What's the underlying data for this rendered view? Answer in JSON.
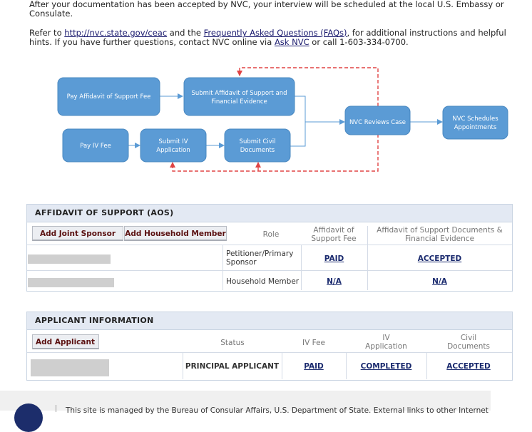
{
  "intro": {
    "p1": "After your documentation has been accepted by NVC, your interview will be scheduled at the local U.S. Embassy or Consulate.",
    "p2_pre": "Refer to ",
    "p2_link1": "http://nvc.state.gov/ceac",
    "p2_mid": " and the ",
    "p2_link2": "Frequently Asked Questions (FAQs)",
    "p2_mid2": ", for additional instructions and helpful hints. If you have further questions, contact NVC online via ",
    "p2_link3": "Ask NVC",
    "p2_post": " or call 1-603-334-0700."
  },
  "flowchart": {
    "box_color": "#5b9bd5",
    "arrow_color": "#5b9bd5",
    "dash_color": "#e04444",
    "steps": {
      "pay_aos_fee": "Pay Affidavit of Support Fee",
      "submit_aos_line1": "Submit Affidavit of Support and",
      "submit_aos_line2": "Financial Evidence",
      "pay_iv_fee": "Pay IV Fee",
      "submit_iv_line1": "Submit IV",
      "submit_iv_line2": "Application",
      "submit_civil_line1": "Submit Civil",
      "submit_civil_line2": "Documents",
      "nvc_reviews": "NVC Reviews Case",
      "nvc_schedules_line1": "NVC Schedules",
      "nvc_schedules_line2": "Appointments"
    }
  },
  "aos": {
    "title": "AFFIDAVIT OF SUPPORT (AOS)",
    "add_joint_sponsor": "Add Joint Sponsor",
    "add_household_member": "Add Household Member",
    "col_role": "Role",
    "col_fee_line1": "Affidavit of",
    "col_fee_line2": "Support Fee",
    "col_docs_line1": "Affidavit of Support Documents &",
    "col_docs_line2": "Financial Evidence",
    "rows": [
      {
        "role_line1": "Petitioner/Primary",
        "role_line2": "Sponsor",
        "fee": "PAID",
        "docs": "ACCEPTED"
      },
      {
        "role_line1": "Household Member",
        "role_line2": "",
        "fee": "N/A",
        "docs": "N/A"
      }
    ]
  },
  "applicant": {
    "title": "APPLICANT INFORMATION",
    "add_applicant": "Add Applicant",
    "col_status": "Status",
    "col_iv_fee": "IV Fee",
    "col_iv_app_line1": "IV",
    "col_iv_app_line2": "Application",
    "col_civil_line1": "Civil",
    "col_civil_line2": "Documents",
    "rows": [
      {
        "status": "PRINCIPAL APPLICANT",
        "iv_fee": "PAID",
        "iv_app": "COMPLETED",
        "civil": "ACCEPTED"
      }
    ]
  },
  "footer": {
    "text": "This site is managed by the Bureau of Consular Affairs, U.S. Department of State. External links to other Internet"
  }
}
